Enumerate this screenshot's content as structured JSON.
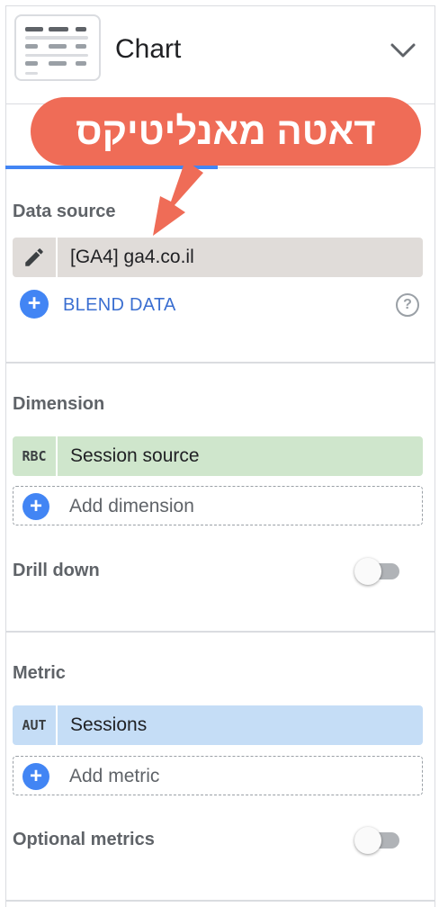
{
  "header": {
    "title": "Chart"
  },
  "callout": {
    "text": "דאטה מאנליטיקס"
  },
  "data_source": {
    "label": "Data source",
    "value": "[GA4] ga4.co.il",
    "blend_label": "BLEND DATA",
    "help_glyph": "?"
  },
  "dimension": {
    "label": "Dimension",
    "badge": "RBC",
    "value": "Session source",
    "add_label": "Add dimension",
    "drill_down_label": "Drill down",
    "drill_down_on": false
  },
  "metric": {
    "label": "Metric",
    "badge": "AUT",
    "value": "Sessions",
    "add_label": "Add metric",
    "optional_label": "Optional metrics",
    "optional_on": false
  },
  "colors": {
    "accent_blue": "#4285f4",
    "callout_red": "#ef6c57",
    "dimension_green": "#cfe6cc",
    "metric_blue": "#c5ddf6",
    "source_gray": "#e0dcd9"
  }
}
